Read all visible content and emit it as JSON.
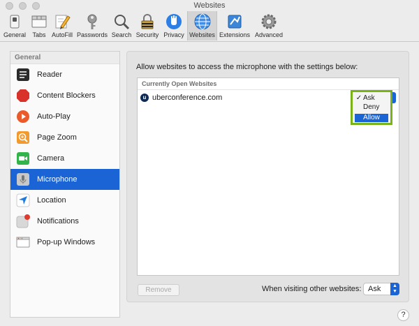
{
  "window": {
    "title": "Websites"
  },
  "toolbar": {
    "items": [
      {
        "label": "General",
        "icon": "switch-icon"
      },
      {
        "label": "Tabs",
        "icon": "tabs-icon"
      },
      {
        "label": "AutoFill",
        "icon": "pencil-icon"
      },
      {
        "label": "Passwords",
        "icon": "key-icon"
      },
      {
        "label": "Search",
        "icon": "search-icon"
      },
      {
        "label": "Security",
        "icon": "lock-icon"
      },
      {
        "label": "Privacy",
        "icon": "hand-icon"
      },
      {
        "label": "Websites",
        "icon": "globe-icon",
        "active": true
      },
      {
        "label": "Extensions",
        "icon": "puzzle-icon"
      },
      {
        "label": "Advanced",
        "icon": "gear-icon"
      }
    ]
  },
  "sidebar": {
    "header": "General",
    "items": [
      {
        "label": "Reader",
        "icon": "reader-icon"
      },
      {
        "label": "Content Blockers",
        "icon": "stop-icon"
      },
      {
        "label": "Auto-Play",
        "icon": "play-icon"
      },
      {
        "label": "Page Zoom",
        "icon": "zoom-icon"
      },
      {
        "label": "Camera",
        "icon": "camera-icon"
      },
      {
        "label": "Microphone",
        "icon": "microphone-icon",
        "selected": true
      },
      {
        "label": "Location",
        "icon": "location-icon"
      },
      {
        "label": "Notifications",
        "icon": "notifications-icon"
      },
      {
        "label": "Pop-up Windows",
        "icon": "popup-windows-icon"
      }
    ]
  },
  "main": {
    "prompt": "Allow websites to access the microphone with the settings below:",
    "table_header": "Currently Open Websites",
    "sites": [
      {
        "name": "uberconference.com",
        "favicon_letter": "u"
      }
    ],
    "permission_menu": {
      "options": [
        {
          "label": "Ask",
          "checked": true
        },
        {
          "label": "Deny",
          "checked": false
        },
        {
          "label": "Allow",
          "highlighted": true
        }
      ]
    },
    "remove_label": "Remove",
    "other_label": "When visiting other websites:",
    "other_value": "Ask",
    "help_label": "?"
  },
  "colors": {
    "accent": "#1a64d6",
    "highlight_box": "#7ab317"
  }
}
